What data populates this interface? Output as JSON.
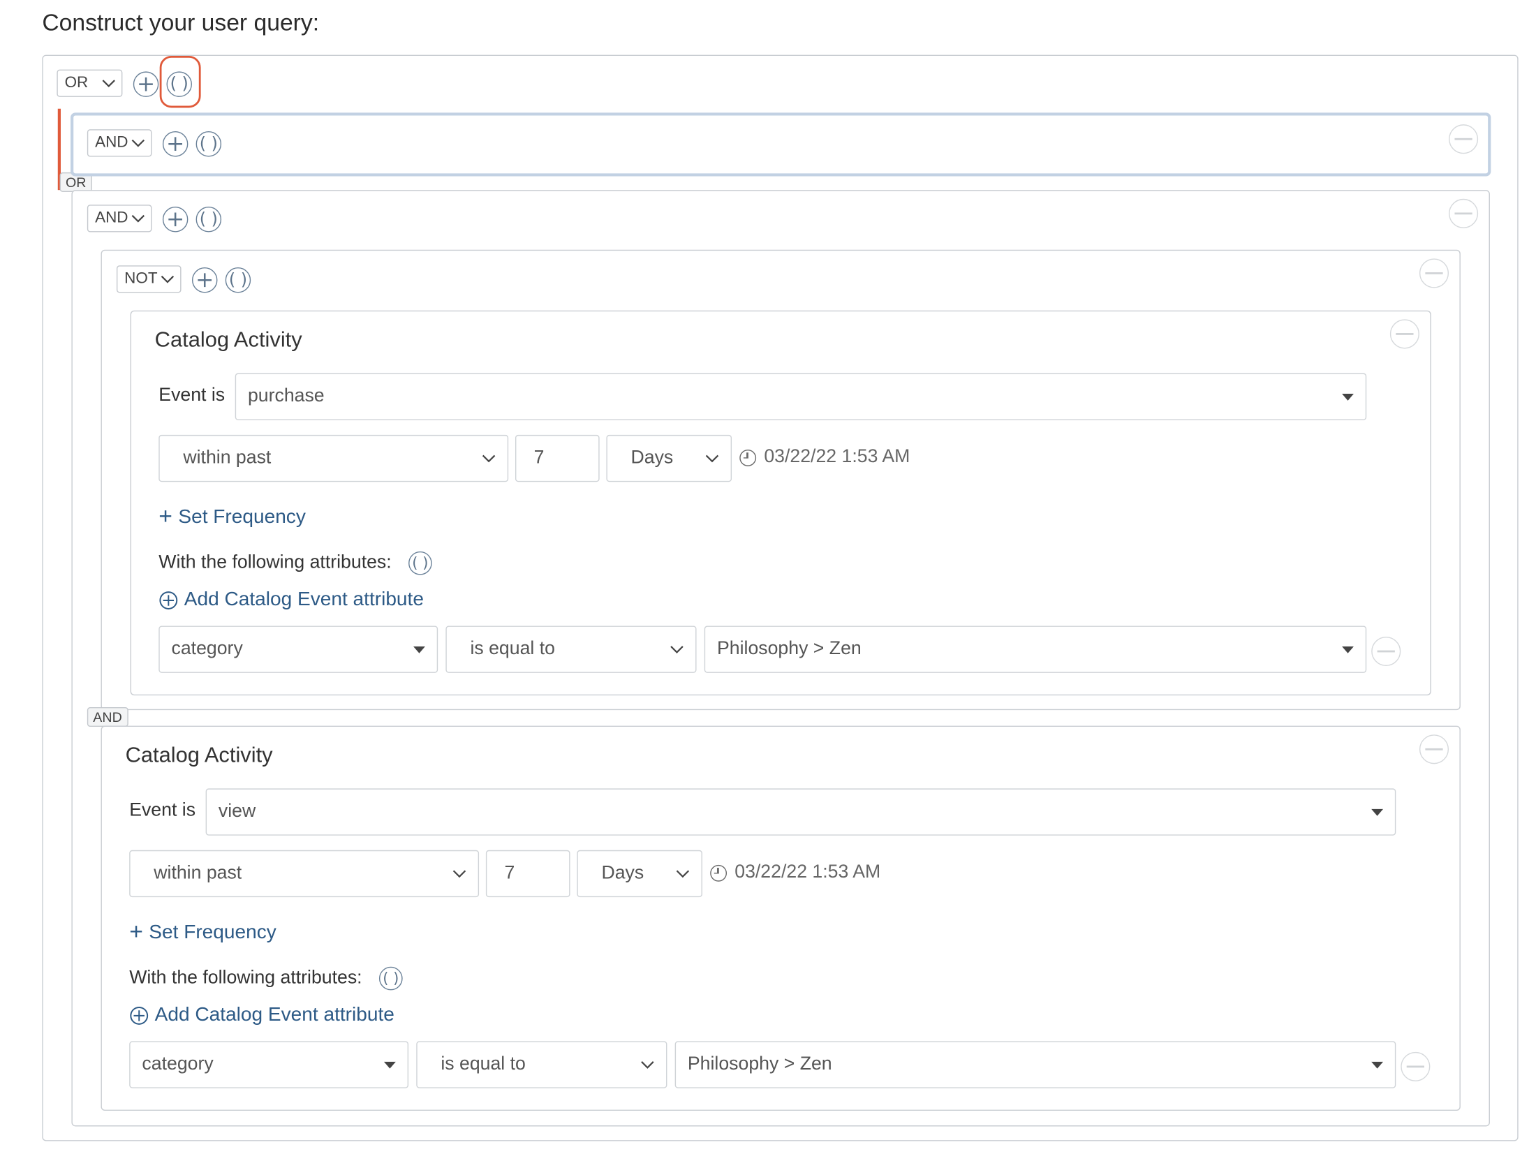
{
  "heading": "Construct your user query:",
  "root": {
    "operator": "OR",
    "add_label": "+",
    "group_label": "( )"
  },
  "connectors": {
    "or": "OR",
    "and": "AND"
  },
  "group1": {
    "operator": "AND"
  },
  "group2": {
    "operator": "AND"
  },
  "group3": {
    "operator": "NOT"
  },
  "conditions": [
    {
      "title": "Catalog Activity",
      "event_label": "Event is",
      "event_value": "purchase",
      "time_mode": "within past",
      "amount": "7",
      "unit": "Days",
      "timestamp": "03/22/22 1:53 AM",
      "set_frequency": "Set Frequency",
      "attributes_label": "With the following attributes:",
      "add_attribute": "Add Catalog Event attribute",
      "attr_field": "category",
      "attr_operator": "is equal to",
      "attr_value": "Philosophy > Zen"
    },
    {
      "title": "Catalog Activity",
      "event_label": "Event is",
      "event_value": "view",
      "time_mode": "within past",
      "amount": "7",
      "unit": "Days",
      "timestamp": "03/22/22 1:53 AM",
      "set_frequency": "Set Frequency",
      "attributes_label": "With the following attributes:",
      "add_attribute": "Add Catalog Event attribute",
      "attr_field": "category",
      "attr_operator": "is equal to",
      "attr_value": "Philosophy > Zen"
    }
  ],
  "colors": {
    "accent": "#2d5a86",
    "highlight": "#e05a3a",
    "selected_border": "#c2d1e3"
  }
}
